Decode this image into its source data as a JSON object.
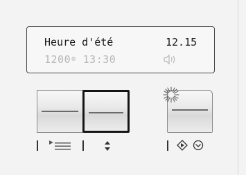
{
  "display": {
    "line1_label": "Heure d'été",
    "line1_time": "12.15",
    "line2_value": "1200",
    "line2_time": "13:30",
    "gear_symbol": "⚙",
    "speaker_icon": "speaker-icon"
  },
  "buttons": [
    {
      "name": "left-button",
      "selected": false,
      "icon": "list-icon"
    },
    {
      "name": "middle-button",
      "selected": true,
      "icon": "up-down-arrows-icon"
    },
    {
      "name": "right-button",
      "selected": false,
      "icon": "start-stop-icon",
      "lit": true
    }
  ],
  "colors": {
    "display_dim": "#b8b8b8",
    "frame": "#151515",
    "panel": "#f3f3f3"
  }
}
